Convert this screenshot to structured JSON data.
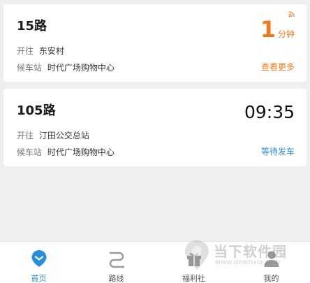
{
  "arrivals": [
    {
      "route": "15路",
      "direction_label": "开往",
      "direction": "东安村",
      "stop_label": "候车站",
      "stop": "时代广场购物中心",
      "eta_value": "1",
      "eta_unit": "分钟",
      "action": "查看更多"
    },
    {
      "route": "105路",
      "direction_label": "开往",
      "direction": "汀田公交总站",
      "stop_label": "候车站",
      "stop": "时代广场购物中心",
      "schedule_time": "09:35",
      "action": "等待发车"
    }
  ],
  "tabbar": {
    "items": [
      {
        "label": "首页",
        "icon": "home-pin-icon",
        "active": true
      },
      {
        "label": "路线",
        "icon": "route-icon",
        "active": false
      },
      {
        "label": "福利社",
        "icon": "gift-icon",
        "active": false
      },
      {
        "label": "我的",
        "icon": "user-icon",
        "active": false
      }
    ]
  },
  "watermark": {
    "text": "当下软件园",
    "url": "www.downxia.com"
  },
  "colors": {
    "accent_orange": "#f07a1a",
    "accent_blue": "#2a8fd6",
    "background": "#efefef"
  }
}
